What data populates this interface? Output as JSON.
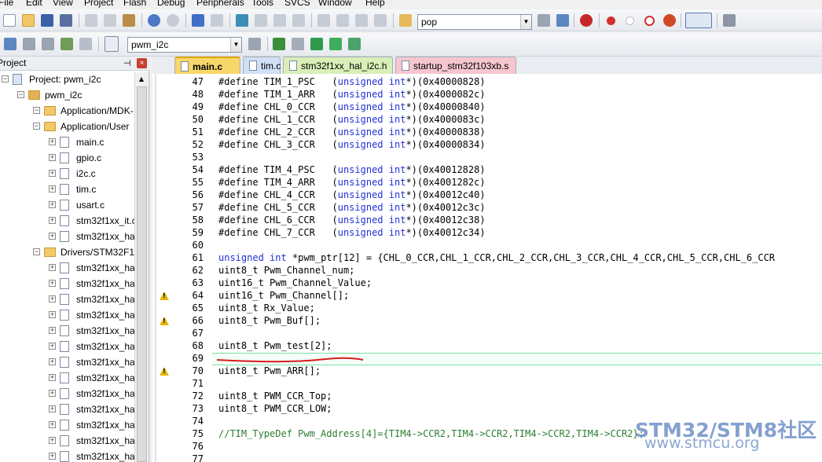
{
  "menu": [
    "File",
    "Edit",
    "View",
    "Project",
    "Flash",
    "Debug",
    "Peripherals",
    "Tools",
    "SVCS",
    "Window",
    "Help"
  ],
  "toolbar": {
    "find_combo_value": "pop",
    "target_combo_value": "pwm_i2c"
  },
  "project_panel": {
    "title": "Project",
    "tree": [
      {
        "label": "Project: pwm_i2c",
        "level": 0,
        "kind": "project"
      },
      {
        "label": "pwm_i2c",
        "level": 1,
        "kind": "target"
      },
      {
        "label": "Application/MDK-",
        "level": 2,
        "kind": "folder"
      },
      {
        "label": "Application/User",
        "level": 2,
        "kind": "folder"
      },
      {
        "label": "main.c",
        "level": 3,
        "kind": "file"
      },
      {
        "label": "gpio.c",
        "level": 3,
        "kind": "file"
      },
      {
        "label": "i2c.c",
        "level": 3,
        "kind": "file"
      },
      {
        "label": "tim.c",
        "level": 3,
        "kind": "file"
      },
      {
        "label": "usart.c",
        "level": 3,
        "kind": "file"
      },
      {
        "label": "stm32f1xx_it.c",
        "level": 3,
        "kind": "file"
      },
      {
        "label": "stm32f1xx_hal_",
        "level": 3,
        "kind": "file"
      },
      {
        "label": "Drivers/STM32F1x",
        "level": 2,
        "kind": "folder"
      },
      {
        "label": "stm32f1xx_hal_",
        "level": 3,
        "kind": "file"
      },
      {
        "label": "stm32f1xx_hal_",
        "level": 3,
        "kind": "file"
      },
      {
        "label": "stm32f1xx_hal_",
        "level": 3,
        "kind": "file"
      },
      {
        "label": "stm32f1xx_hal_",
        "level": 3,
        "kind": "file"
      },
      {
        "label": "stm32f1xx_hal_",
        "level": 3,
        "kind": "file"
      },
      {
        "label": "stm32f1xx_hal_",
        "level": 3,
        "kind": "file"
      },
      {
        "label": "stm32f1xx_hal_",
        "level": 3,
        "kind": "file"
      },
      {
        "label": "stm32f1xx_hal_",
        "level": 3,
        "kind": "file"
      },
      {
        "label": "stm32f1xx_hal_",
        "level": 3,
        "kind": "file"
      },
      {
        "label": "stm32f1xx_hal_",
        "level": 3,
        "kind": "file"
      },
      {
        "label": "stm32f1xx_hal_",
        "level": 3,
        "kind": "file"
      },
      {
        "label": "stm32f1xx_hal_",
        "level": 3,
        "kind": "file"
      },
      {
        "label": "stm32f1xx_hal_",
        "level": 3,
        "kind": "file"
      }
    ]
  },
  "tabs": [
    {
      "label": "main.c",
      "active": true,
      "color": "#f7d76a"
    },
    {
      "label": "tim.c",
      "active": false,
      "color": "#cfe0f7"
    },
    {
      "label": "stm32f1xx_hal_i2c.h",
      "active": false,
      "color": "#d8efb8"
    },
    {
      "label": "startup_stm32f103xb.s",
      "active": false,
      "color": "#f6c6cf"
    }
  ],
  "code": [
    {
      "n": "47",
      "text": "#define TIM_1_PSC   (unsigned int*)(0x40000828)"
    },
    {
      "n": "48",
      "text": "#define TIM_1_ARR   (unsigned int*)(0x4000082c)"
    },
    {
      "n": "49",
      "text": "#define CHL_0_CCR   (unsigned int*)(0x40000840)"
    },
    {
      "n": "50",
      "text": "#define CHL_1_CCR   (unsigned int*)(0x4000083c)"
    },
    {
      "n": "51",
      "text": "#define CHL_2_CCR   (unsigned int*)(0x40000838)"
    },
    {
      "n": "52",
      "text": "#define CHL_3_CCR   (unsigned int*)(0x40000834)"
    },
    {
      "n": "53",
      "text": ""
    },
    {
      "n": "54",
      "text": "#define TIM_4_PSC   (unsigned int*)(0x40012828)"
    },
    {
      "n": "55",
      "text": "#define TIM_4_ARR   (unsigned int*)(0x4001282c)"
    },
    {
      "n": "56",
      "text": "#define CHL_4_CCR   (unsigned int*)(0x40012c40)"
    },
    {
      "n": "57",
      "text": "#define CHL_5_CCR   (unsigned int*)(0x40012c3c)"
    },
    {
      "n": "58",
      "text": "#define CHL_6_CCR   (unsigned int*)(0x40012c38)"
    },
    {
      "n": "59",
      "text": "#define CHL_7_CCR   (unsigned int*)(0x40012c34)"
    },
    {
      "n": "60",
      "text": ""
    },
    {
      "n": "61",
      "text": "unsigned int *pwm_ptr[12] = {CHL_0_CCR,CHL_1_CCR,CHL_2_CCR,CHL_3_CCR,CHL_4_CCR,CHL_5_CCR,CHL_6_CCR"
    },
    {
      "n": "62",
      "text": "uint8_t Pwm_Channel_num;"
    },
    {
      "n": "63",
      "text": "uint16_t Pwm_Channel_Value;"
    },
    {
      "n": "64",
      "text": "uint16_t Pwm_Channel[];",
      "warn": true
    },
    {
      "n": "65",
      "text": "uint8_t Rx_Value;"
    },
    {
      "n": "66",
      "text": "uint8_t Pwm_Buf[];",
      "warn": true
    },
    {
      "n": "67",
      "text": ""
    },
    {
      "n": "68",
      "text": "uint8_t Pwm_test[2];"
    },
    {
      "n": "69",
      "text": ""
    },
    {
      "n": "70",
      "text": "uint8_t Pwm_ARR[];",
      "warn": true
    },
    {
      "n": "71",
      "text": ""
    },
    {
      "n": "72",
      "text": "uint8_t PWM_CCR_Top;"
    },
    {
      "n": "73",
      "text": "uint8_t PWM_CCR_LOW;"
    },
    {
      "n": "74",
      "text": ""
    },
    {
      "n": "75",
      "text": "//TIM_TypeDef Pwm_Address[4]={TIM4->CCR2,TIM4->CCR2,TIM4->CCR2,TIM4->CCR2};"
    },
    {
      "n": "76",
      "text": ""
    },
    {
      "n": "77",
      "text": ""
    }
  ],
  "watermark": {
    "line1": "STM32/STM8社区",
    "line2": "www.stmcu.org"
  }
}
